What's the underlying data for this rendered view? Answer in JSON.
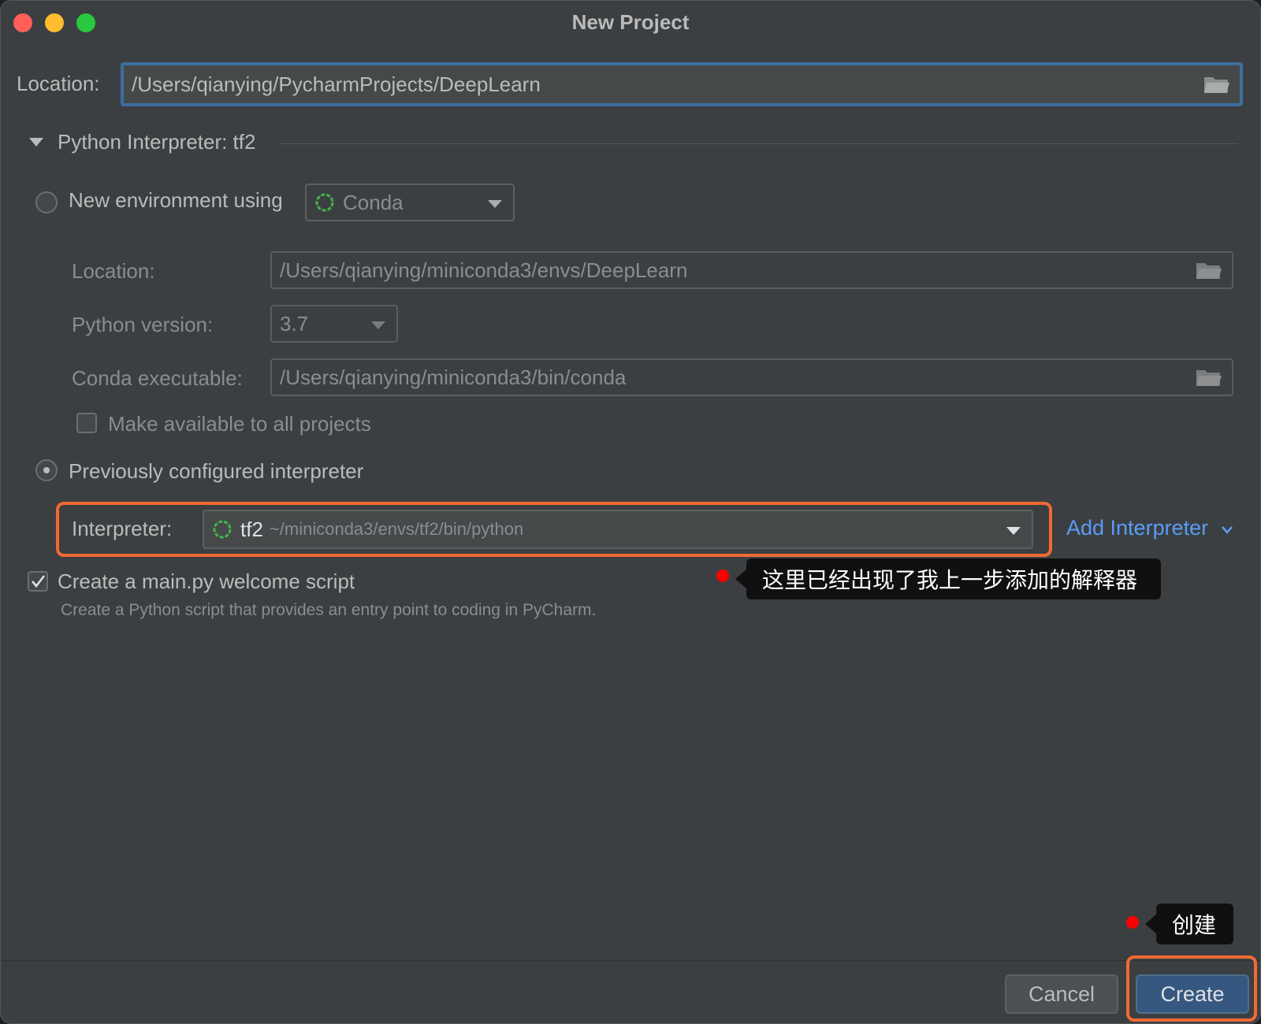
{
  "window": {
    "title": "New Project",
    "traffic_lights": [
      "close",
      "minimize",
      "maximize"
    ]
  },
  "project": {
    "location_label": "Location:",
    "location_value": "/Users/qianying/PycharmProjects/DeepLearn"
  },
  "interpreter_section": {
    "title": "Python Interpreter: tf2",
    "expanded": true
  },
  "new_env": {
    "radio_label": "New environment using",
    "selected": false,
    "tool": "Conda",
    "location_label": "Location:",
    "location_value": "/Users/qianying/miniconda3/envs/DeepLearn",
    "python_version_label": "Python version:",
    "python_version_value": "3.7",
    "conda_exec_label": "Conda executable:",
    "conda_exec_value": "/Users/qianying/miniconda3/bin/conda",
    "make_available_label": "Make available to all projects",
    "make_available_checked": false
  },
  "previous": {
    "radio_label": "Previously configured interpreter",
    "selected": true,
    "interpreter_label": "Interpreter:",
    "interpreter_name": "tf2",
    "interpreter_path": "~/miniconda3/envs/tf2/bin/python",
    "add_interpreter_label": "Add Interpreter"
  },
  "welcome": {
    "checkbox_label": "Create a main.py welcome script",
    "checked": true,
    "description": "Create a Python script that provides an entry point to coding in PyCharm."
  },
  "annotations": {
    "interpreter_note": "这里已经出现了我上一步添加的解释器",
    "create_note": "创建",
    "highlight_color": "#ef6a34",
    "dot_color": "#ff0000"
  },
  "buttons": {
    "cancel": "Cancel",
    "create": "Create"
  },
  "icons": {
    "folder": "folder-icon",
    "conda": "conda-icon",
    "dropdown": "chevron-down-icon",
    "collapse": "triangle-down-icon"
  }
}
